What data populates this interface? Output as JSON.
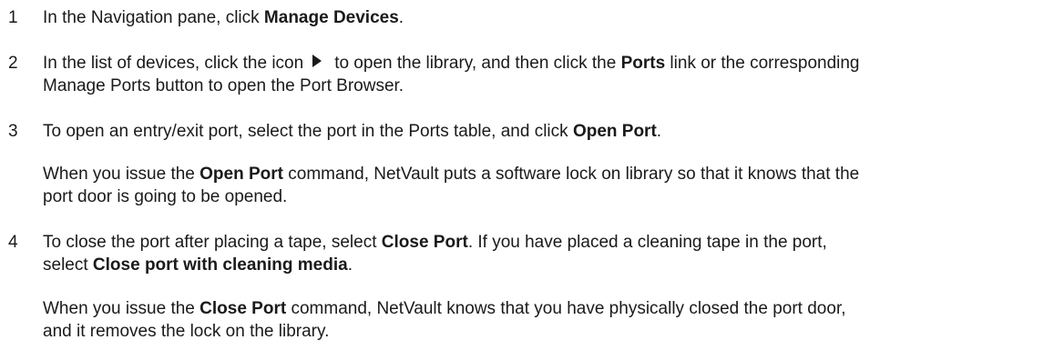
{
  "steps": [
    {
      "number": "1",
      "p1": {
        "a": "In the Navigation pane, click ",
        "b": "Manage Devices",
        "c": "."
      }
    },
    {
      "number": "2",
      "p1": {
        "a": "In the list of devices, click the icon",
        "icon": "play-arrow-icon",
        "b": "to open the library, and then click the ",
        "c": "Ports",
        "d": " link or the corresponding",
        "e": "Manage Ports button to open the Port Browser."
      }
    },
    {
      "number": "3",
      "p1": {
        "a": "To open an entry/exit port, select the port in the Ports table, and click ",
        "b": "Open Port",
        "c": "."
      },
      "p2": {
        "a": "When you issue the ",
        "b": "Open Port",
        "c": " command, NetVault puts a software lock on library so that it knows that the",
        "d": "port door is going to be opened."
      }
    },
    {
      "number": "4",
      "p1": {
        "a": "To close the port after placing a tape, select ",
        "b": "Close Port",
        "c": ". If you have placed a cleaning tape in the port,",
        "d": "select ",
        "e": "Close port with cleaning media",
        "f": "."
      },
      "p2": {
        "a": "When you issue the ",
        "b": "Close Port",
        "c": " command, NetVault knows that you have physically closed the port door,",
        "d": "and it removes the lock on the library."
      }
    }
  ]
}
